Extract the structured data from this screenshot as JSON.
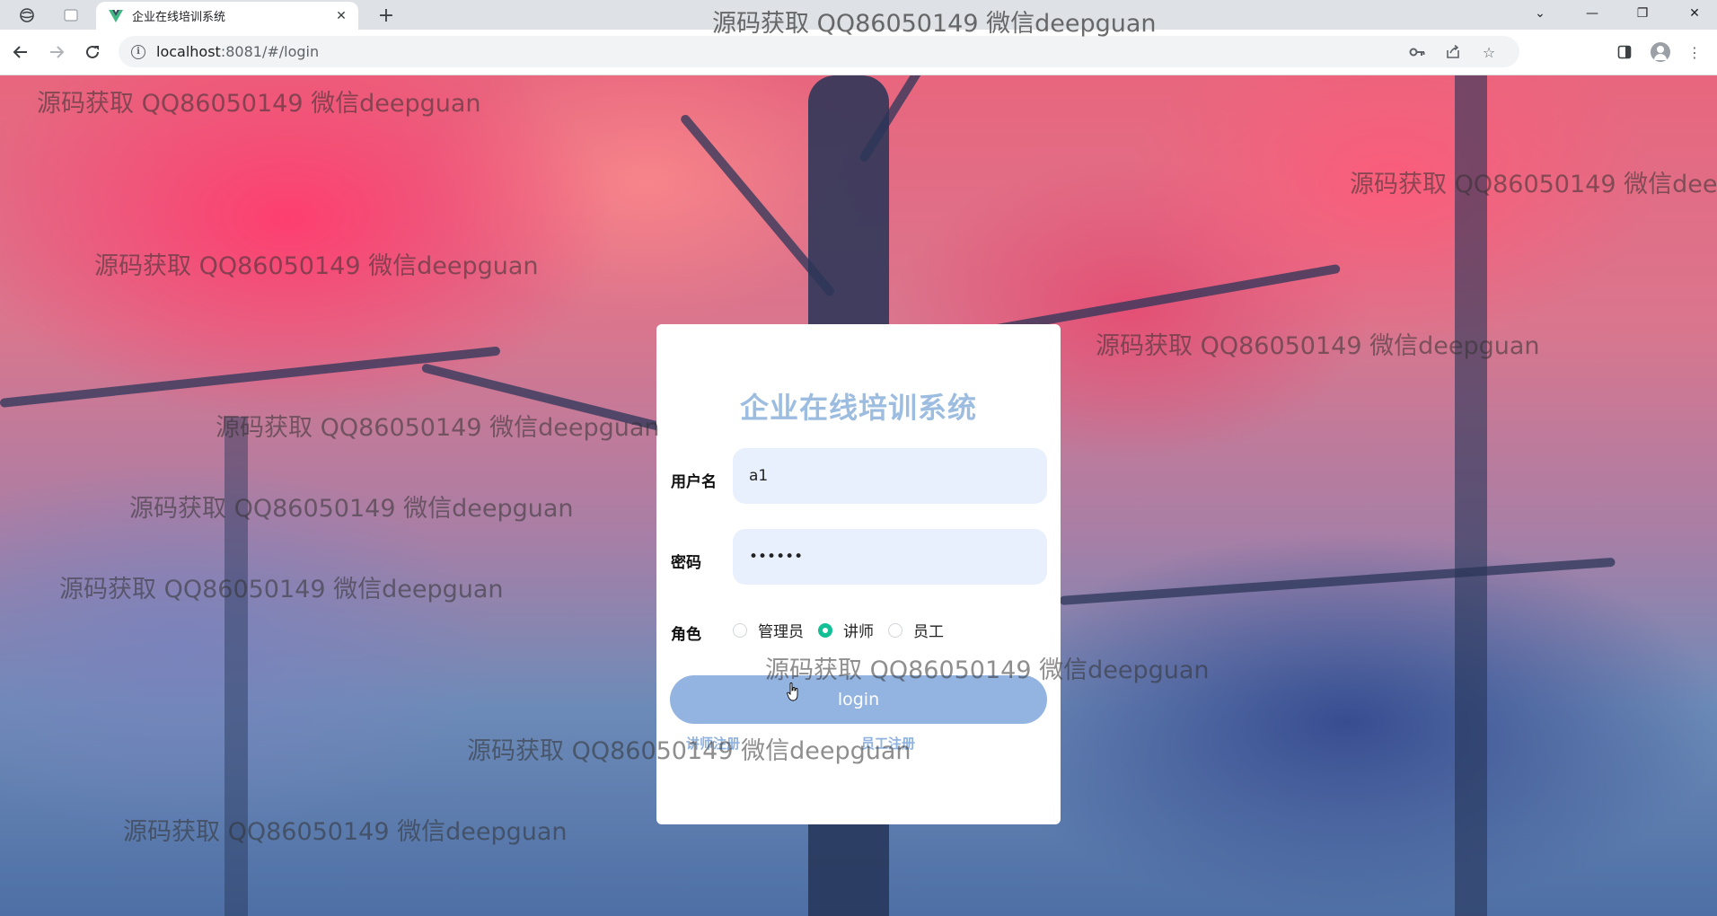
{
  "browser": {
    "tab_title": "企业在线培训系统",
    "url_host": "localhost",
    "url_rest": ":8081/#/login"
  },
  "login": {
    "title": "企业在线培训系统",
    "username_label": "用户名",
    "username_value": "a1",
    "password_label": "密码",
    "password_value": "••••••",
    "role_label": "角色",
    "roles": [
      "管理员",
      "讲师",
      "员工"
    ],
    "selected_role": "讲师",
    "login_button": "login",
    "register_teacher_link": "讲师注册",
    "register_employee_link": "员工注册"
  },
  "watermark_text": "源码获取 QQ86050149 微信deepguan",
  "colors": {
    "title": "#9cbce0",
    "input_bg": "#e8f0fe",
    "button": "#93b4e0",
    "radio_checked": "#13c095",
    "link": "#8fb2de"
  }
}
